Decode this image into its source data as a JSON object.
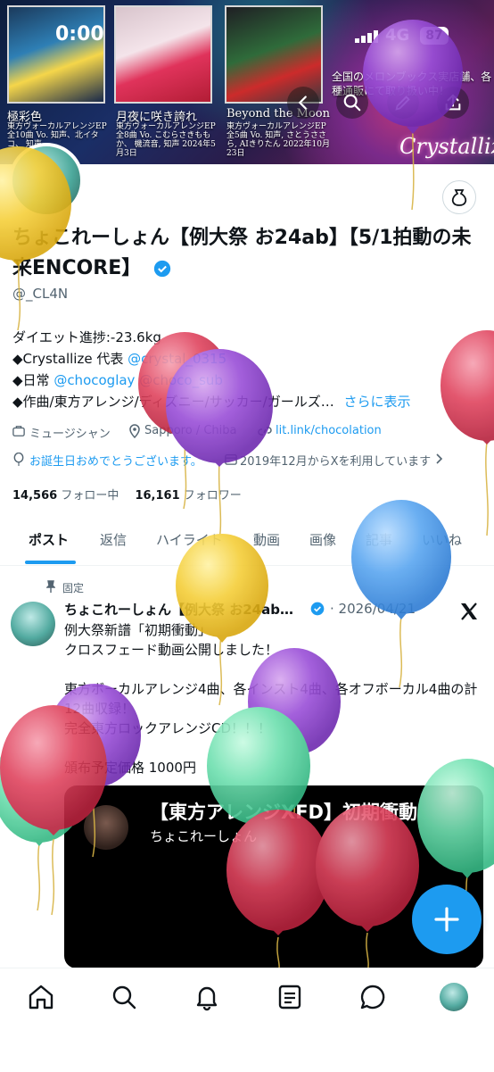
{
  "status_bar": {
    "time": "0:00",
    "network": "4G",
    "battery": "87"
  },
  "banner": {
    "albums": [
      {
        "title": "極彩色",
        "subtitle": "東方ヴォーカルアレンジEP 全10曲 Vo. 知声、北イタコ、 知声"
      },
      {
        "title": "月夜に咲き誇れ",
        "subtitle": "東方ヴォーカルアレンジEP 全8曲 Vo. こむらさきももか、 機流音, 知声 2024年5月3日"
      },
      {
        "title": "Beyond the Moon",
        "subtitle": "東方ヴォーカルアレンジEP 全5曲 Vo. 知声, さとうささら, AIきりたん 2022年10月23日"
      }
    ],
    "shop_text": "全国のメロンブックス実店舗、各種通販にて取り扱い中！",
    "brand": "Crystallize"
  },
  "profile": {
    "display_name": "ちょこれーしょん【例大祭 お24ab】【5/1拍動の未来ENCORE】",
    "handle": "@_CL4N",
    "bio_line1": "ダイエット進捗:-23.6kg",
    "bio_line2_prefix": "◆Crystallize 代表 ",
    "bio_line2_link": "@crystal_0315",
    "bio_line3_prefix": "◆日常 ",
    "bio_line3_link1": "@chocoglay",
    "bio_line3_link2": "@choco_sub",
    "bio_line4": "◆作曲/東方アレンジ/ディズニー/サッカー/ガールズ…",
    "show_more": "さらに表示",
    "category": "ミュージシャン",
    "location": "Sapporo / Chiba",
    "website": "lit.link/chocolation",
    "birthday": "お誕生日おめでとうございます。",
    "joined": "2019年12月からXを利用しています",
    "following_count": "14,566",
    "following_label": "フォロー中",
    "followers_count": "16,161",
    "followers_label": "フォロワー"
  },
  "tabs": [
    "ポスト",
    "返信",
    "ハイライト",
    "動画",
    "画像",
    "記事",
    "いいね"
  ],
  "pinned_post": {
    "pinned_label": "固定",
    "author": "ちょこれーしょん【例大祭 お24ab…",
    "date": "2026/04/21",
    "body": "例大祭新譜「初期衝動」\nクロスフェード動画公開しました！\n\n東方ボーカルアレンジ4曲、各インスト4曲、各オフボーカル4曲の計12曲収録！\n完全東方ロックアレンジCD！！！\n\n頒布予定価格 1000円",
    "video_title": "【東方アレンジXFD】初期衝動",
    "video_author": "ちょこれーしょん"
  },
  "colors": {
    "accent": "#1d9bf0",
    "text": "#0f1419",
    "muted": "#536471"
  },
  "icons": {
    "back": "arrow-left-icon",
    "search": "search-icon",
    "edit": "pen-icon",
    "share": "share-icon",
    "wallet": "money-bag-icon",
    "fab": "plus-icon",
    "x_logo": "x-logo-icon",
    "nav": [
      "home-icon",
      "search-icon",
      "bell-icon",
      "article-icon",
      "chat-icon"
    ]
  }
}
